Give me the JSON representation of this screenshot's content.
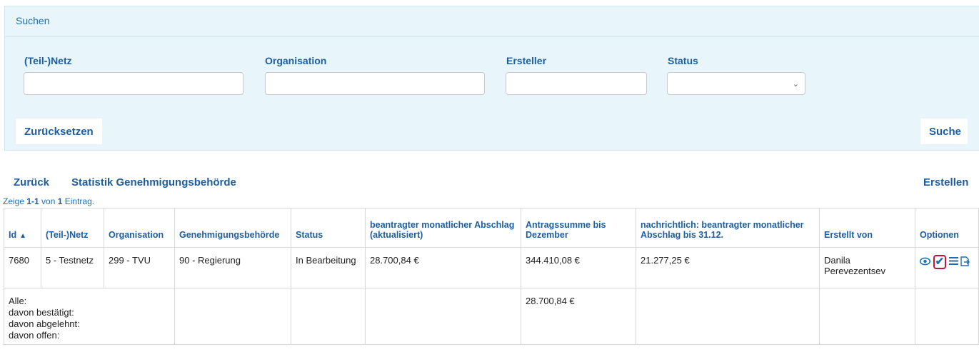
{
  "search": {
    "title": "Suchen",
    "labels": {
      "netz": "(Teil-)Netz",
      "organisation": "Organisation",
      "ersteller": "Ersteller",
      "status": "Status"
    },
    "values": {
      "netz": "",
      "organisation": "",
      "ersteller": "",
      "status": ""
    },
    "reset_label": "Zurücksetzen",
    "search_label": "Suche"
  },
  "nav": {
    "back_label": "Zurück",
    "stats_label": "Statistik Genehmigungsbehörde",
    "create_label": "Erstellen"
  },
  "summary": {
    "prefix": "Zeige ",
    "range": "1-1",
    "middle": " von ",
    "total": "1",
    "suffix": " Eintrag."
  },
  "table": {
    "headers": {
      "id": "Id",
      "netz": "(Teil-)Netz",
      "organisation": "Organisation",
      "behoerde": "Genehmigungsbehörde",
      "status": "Status",
      "abschlag": "beantragter monatlicher Abschlag (aktualisiert)",
      "summe": "Antragssumme bis Dezember",
      "nachrichtlich": "nachrichtlich: beantragter monatlicher Abschlag bis 31.12.",
      "erstellt_von": "Erstellt von",
      "optionen": "Optionen"
    },
    "sort_indicator": "▲",
    "rows": [
      {
        "id": "7680",
        "netz": "5 - Testnetz",
        "organisation": "299 - TVU",
        "behoerde": "90 - Regierung",
        "status": "In Bearbeitung",
        "abschlag": "28.700,84 €",
        "summe": "344.410,08 €",
        "nachrichtlich": "21.277,25 €",
        "erstellt_von": "Danila Perevezentsev"
      }
    ],
    "totals": {
      "alle": "Alle:",
      "bestaetigt": "davon bestätigt:",
      "abgelehnt": "davon abgelehnt:",
      "offen": "davon offen:",
      "summe_alle": "28.700,84 €"
    },
    "option_icons": [
      "eye-icon",
      "checkmark-icon",
      "list-icon",
      "document-export-icon"
    ]
  },
  "colors": {
    "accent": "#1d5ea0",
    "panel_bg": "#e8f5fb",
    "highlight": "#c0143c"
  }
}
